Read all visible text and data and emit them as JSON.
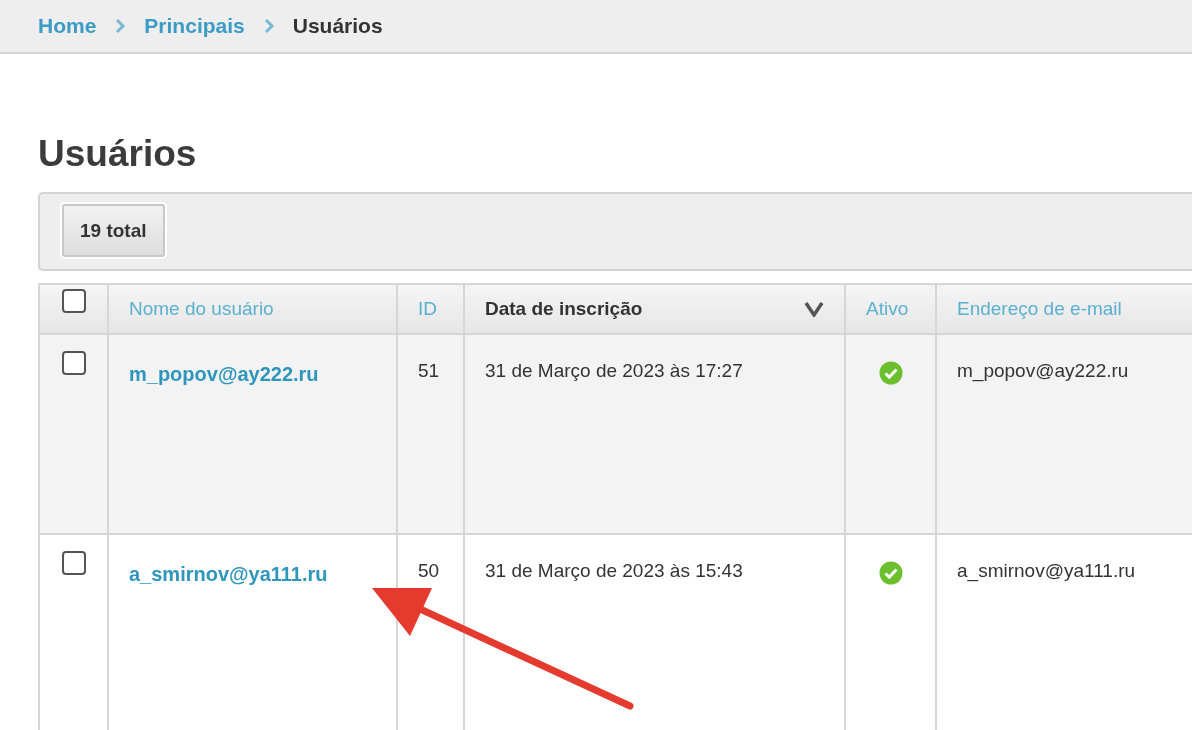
{
  "breadcrumb": [
    {
      "label": "Home",
      "current": false
    },
    {
      "label": "Principais",
      "current": false
    },
    {
      "label": "Usuários",
      "current": true
    }
  ],
  "title": "Usuários",
  "toolbar": {
    "total_button": "19 total"
  },
  "table": {
    "select_all_checked": false,
    "columns": [
      {
        "label": "Nome do usuário",
        "sorted": false
      },
      {
        "label": "ID",
        "sorted": false
      },
      {
        "label": "Data de inscrição",
        "sorted": true
      },
      {
        "label": "Ativo",
        "sorted": false
      },
      {
        "label": "Endereço de e-mail",
        "sorted": false
      }
    ],
    "rows": [
      {
        "checked": false,
        "username": "m_popov@ay222.ru",
        "id": "51",
        "signup": "31 de Março de 2023 às 17:27",
        "active": true,
        "email": "m_popov@ay222.ru"
      },
      {
        "checked": false,
        "username": "a_smirnov@ya111.ru",
        "id": "50",
        "signup": "31 de Março de 2023 às 15:43",
        "active": true,
        "email": "a_smirnov@ya111.ru"
      }
    ]
  }
}
